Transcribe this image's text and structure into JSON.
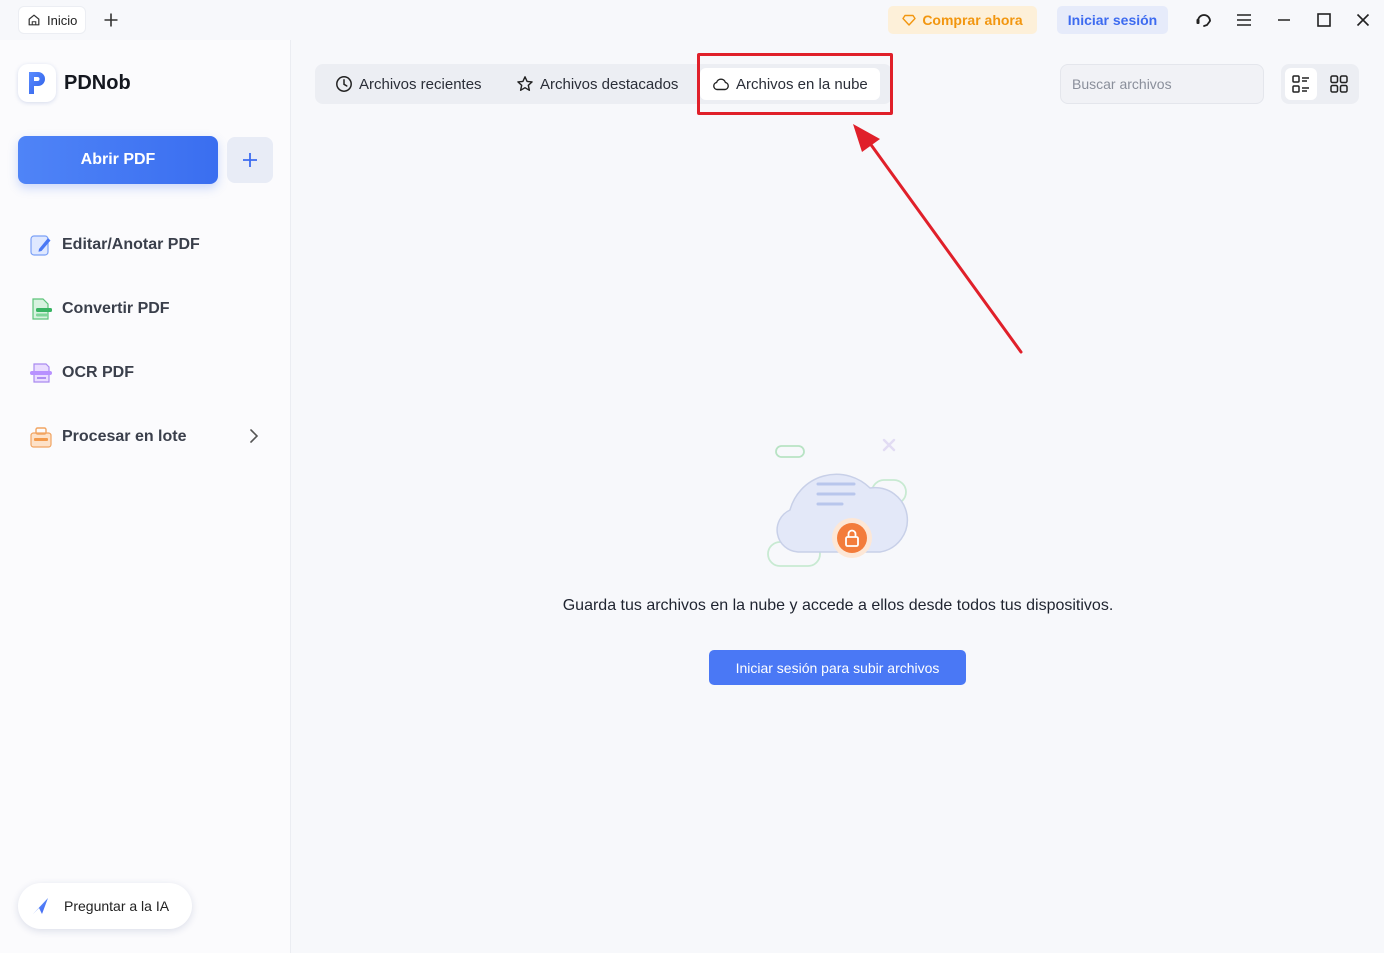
{
  "titlebar": {
    "home_tab_label": "Inicio",
    "buy_label": "Comprar ahora",
    "login_label": "Iniciar sesión"
  },
  "sidebar": {
    "brand": "PDNob",
    "open_pdf_label": "Abrir PDF",
    "items": [
      {
        "label": "Editar/Anotar PDF",
        "icon": "edit-icon"
      },
      {
        "label": "Convertir PDF",
        "icon": "convert-icon"
      },
      {
        "label": "OCR PDF",
        "icon": "ocr-icon"
      },
      {
        "label": "Procesar en lote",
        "icon": "batch-icon"
      }
    ],
    "ask_ai_label": "Preguntar a la IA"
  },
  "main": {
    "tabs": [
      {
        "label": "Archivos recientes",
        "icon": "clock-icon"
      },
      {
        "label": "Archivos destacados",
        "icon": "star-icon"
      },
      {
        "label": "Archivos en la nube",
        "icon": "cloud-icon",
        "active": true
      }
    ],
    "search_placeholder": "Buscar archivos",
    "empty_message": "Guarda tus archivos en la nube y accede a ellos desde todos tus dispositivos.",
    "cta_label": "Iniciar sesión para subir archivos"
  },
  "colors": {
    "accent": "#4a78f5",
    "buy": "#f2960f",
    "annotation": "#e0202a"
  }
}
